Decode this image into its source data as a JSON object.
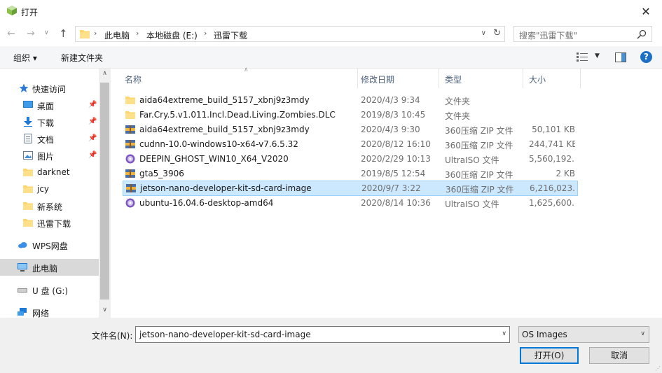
{
  "window": {
    "title": "打开",
    "close_glyph": "✕"
  },
  "address": {
    "crumbs": [
      "此电脑",
      "本地磁盘 (E:)",
      "迅雷下载"
    ],
    "search_placeholder": "搜索\"迅雷下载\""
  },
  "toolbar": {
    "organize": "组织 ▾",
    "new_folder": "新建文件夹"
  },
  "navpane": {
    "items": [
      {
        "label": "快速访问",
        "icon": "star-icon"
      },
      {
        "label": "桌面",
        "icon": "desktop-icon",
        "pinned": true
      },
      {
        "label": "下载",
        "icon": "download-icon",
        "pinned": true
      },
      {
        "label": "文档",
        "icon": "document-icon",
        "pinned": true
      },
      {
        "label": "图片",
        "icon": "picture-icon",
        "pinned": true
      },
      {
        "label": "darknet",
        "icon": "folder-icon"
      },
      {
        "label": "jcy",
        "icon": "folder-icon"
      },
      {
        "label": "新系统",
        "icon": "folder-icon"
      },
      {
        "label": "迅雷下载",
        "icon": "folder-icon"
      },
      {
        "label": "WPS网盘",
        "icon": "cloud-icon"
      },
      {
        "label": "此电脑",
        "icon": "computer-icon",
        "selected": true
      },
      {
        "label": "U 盘 (G:)",
        "icon": "drive-icon"
      },
      {
        "label": "网络",
        "icon": "network-icon"
      }
    ]
  },
  "columns": {
    "name": "名称",
    "date": "修改日期",
    "type": "类型",
    "size": "大小"
  },
  "files": [
    {
      "name": "aida64extreme_build_5157_xbnj9z3mdy",
      "date": "2020/4/3 9:34",
      "type": "文件夹",
      "size": "",
      "icon": "folder-icon"
    },
    {
      "name": "Far.Cry.5.v1.011.Incl.Dead.Living.Zombies.DLC",
      "date": "2019/8/3 10:45",
      "type": "文件夹",
      "size": "",
      "icon": "folder-icon"
    },
    {
      "name": "aida64extreme_build_5157_xbnj9z3mdy",
      "date": "2020/4/3 9:30",
      "type": "360压缩 ZIP 文件",
      "size": "50,101 KB",
      "icon": "zip-icon"
    },
    {
      "name": "cudnn-10.0-windows10-x64-v7.6.5.32",
      "date": "2020/8/12 16:10",
      "type": "360压缩 ZIP 文件",
      "size": "244,741 KB",
      "icon": "zip-icon"
    },
    {
      "name": "DEEPIN_GHOST_WIN10_X64_V2020",
      "date": "2020/2/29 10:13",
      "type": "UltraISO 文件",
      "size": "5,560,192...",
      "icon": "disc-icon"
    },
    {
      "name": "gta5_3906",
      "date": "2019/8/5 12:54",
      "type": "360压缩 ZIP 文件",
      "size": "2 KB",
      "icon": "zip-icon"
    },
    {
      "name": "jetson-nano-developer-kit-sd-card-image",
      "date": "2020/9/7 3:22",
      "type": "360压缩 ZIP 文件",
      "size": "6,216,023...",
      "icon": "zip-icon",
      "selected": true
    },
    {
      "name": "ubuntu-16.04.6-desktop-amd64",
      "date": "2020/8/14 10:36",
      "type": "UltraISO 文件",
      "size": "1,625,600...",
      "icon": "disc-icon"
    }
  ],
  "bottom": {
    "filename_label": "文件名(N):",
    "filename_value": "jetson-nano-developer-kit-sd-card-image",
    "filter_value": "OS Images",
    "open_label": "打开(O)",
    "cancel_label": "取消"
  }
}
